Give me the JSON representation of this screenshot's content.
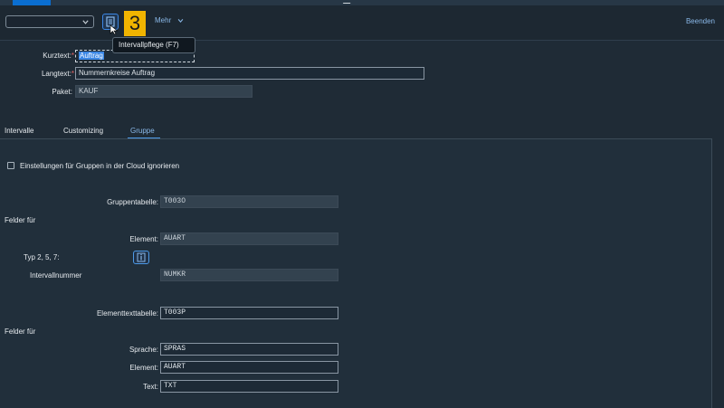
{
  "toolbar": {
    "variant_value": "",
    "step_badge": "3",
    "more_label": "Mehr",
    "exit_label": "Beenden"
  },
  "tooltip": {
    "text": "Intervallpflege   (F7)"
  },
  "header_form": {
    "kurztext": {
      "label": "Kurztext:",
      "required_mark": "*",
      "value": "Auftrag"
    },
    "langtext": {
      "label": "Langtext:",
      "required_mark": "*",
      "value": "Nummernkreise Auftrag"
    },
    "paket": {
      "label": "Paket:",
      "value": "KAUF"
    }
  },
  "tabs": [
    {
      "label": "Intervalle"
    },
    {
      "label": "Customizing"
    },
    {
      "label": "Gruppe",
      "selected": true
    }
  ],
  "gruppe": {
    "cloud_checkbox_label": "Einstellungen für Gruppen in der Cloud ignorieren",
    "cloud_checkbox_checked": false,
    "gruppentabelle": {
      "label": "Gruppentabelle:",
      "value": "T003O"
    },
    "felder_fuer_1": "Felder für",
    "element_1": {
      "label": "Element:",
      "value": "AUART"
    },
    "typ_label": "Typ 2, 5, 7:",
    "intervallnummer": {
      "label": "Intervallnummer",
      "value": "NUMKR"
    },
    "elementtexttabelle": {
      "label": "Elementtexttabelle:",
      "value": "T003P"
    },
    "felder_fuer_2": "Felder für",
    "sprache": {
      "label": "Sprache:",
      "value": "SPRAS"
    },
    "element_2": {
      "label": "Element:",
      "value": "AUART"
    },
    "text": {
      "label": "Text:",
      "value": "TXT"
    }
  },
  "colors": {
    "background": "#1f2b36",
    "accent": "#0a6ed1",
    "link": "#8ab8e8",
    "badge": "#f1b400"
  }
}
